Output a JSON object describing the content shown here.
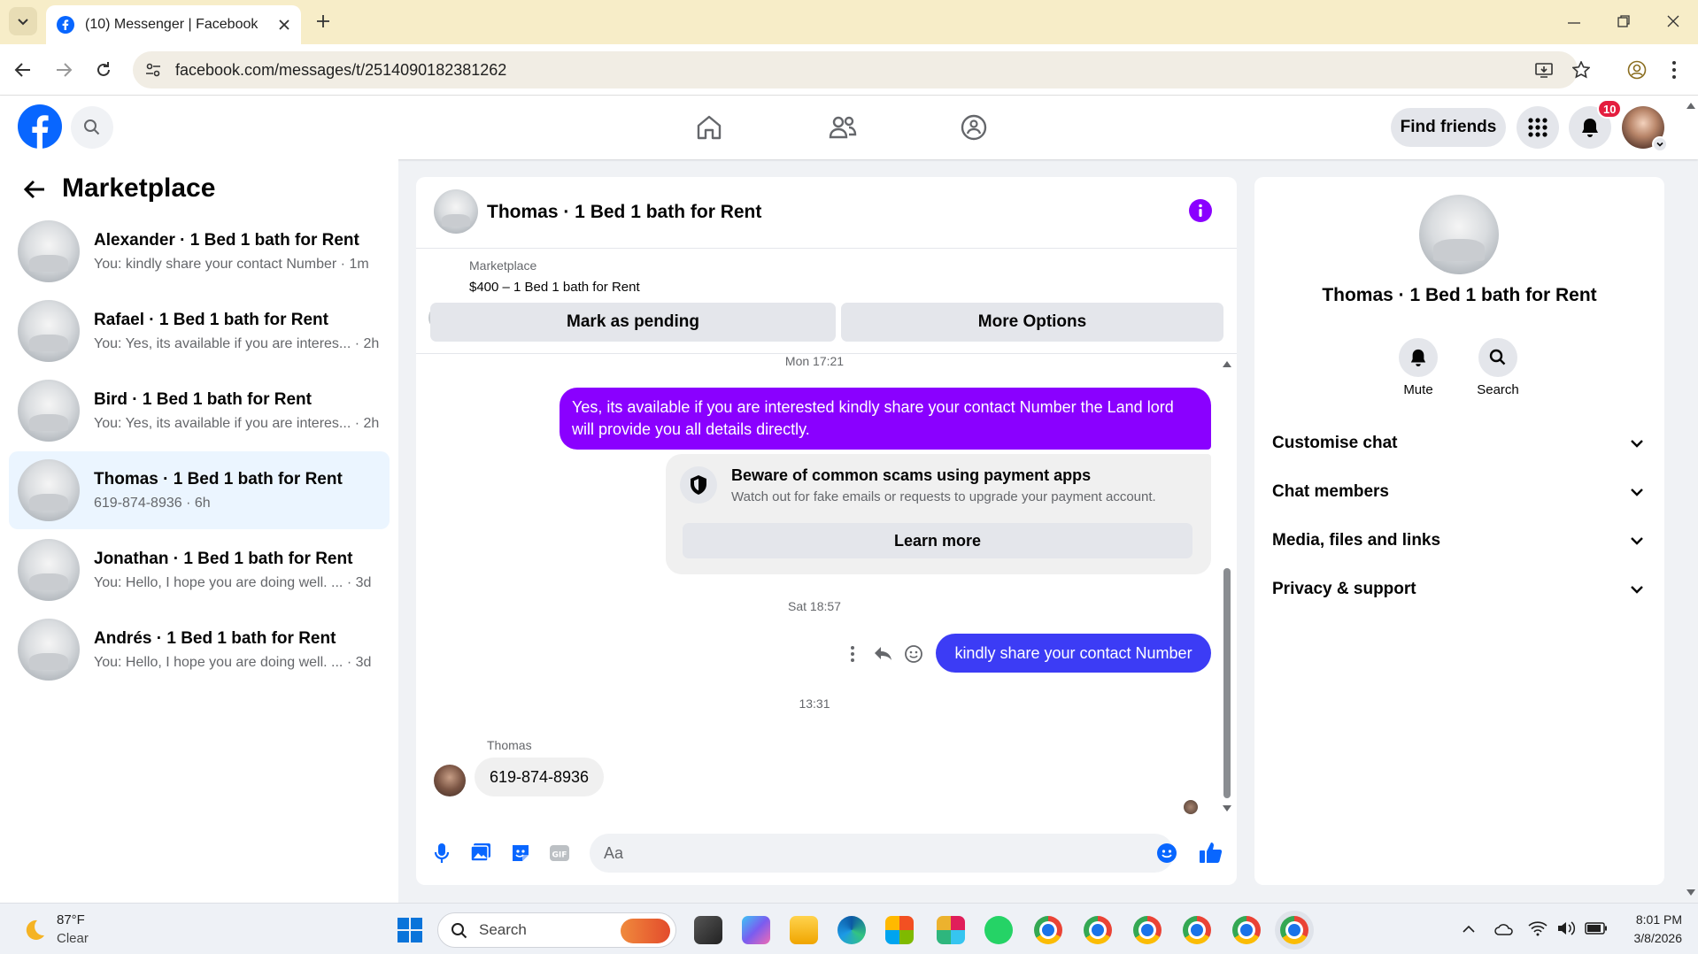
{
  "browser": {
    "tab_title": "(10) Messenger | Facebook",
    "url": "facebook.com/messages/t/2514090182381262"
  },
  "fb_nav": {
    "find_friends_label": "Find friends",
    "notification_count": "10"
  },
  "sidebar": {
    "title": "Marketplace",
    "conversations": [
      {
        "name": "Alexander · 1 Bed 1 bath for Rent",
        "preview": "You: kindly share your contact Number · 1m"
      },
      {
        "name": "Rafael · 1 Bed 1 bath for Rent",
        "preview": "You: Yes, its available if you are interes... · 2h"
      },
      {
        "name": "Bird · 1 Bed 1 bath for Rent",
        "preview": "You: Yes, its available if you are interes... · 2h"
      },
      {
        "name": "Thomas · 1 Bed 1 bath for Rent",
        "preview": "619-874-8936 · 6h"
      },
      {
        "name": "Jonathan · 1 Bed 1 bath for Rent",
        "preview": "You: Hello, I hope you are doing well. ... · 3d"
      },
      {
        "name": "Andrés · 1 Bed 1 bath for Rent",
        "preview": "You: Hello, I hope you are doing well. ... · 3d"
      }
    ]
  },
  "chat": {
    "title": "Thomas · 1 Bed 1 bath for Rent",
    "listing_source": "Marketplace",
    "listing_title": "$400 – 1 Bed 1 bath for Rent",
    "mark_pending_label": "Mark as pending",
    "more_options_label": "More Options",
    "messages": {
      "time1": "Mon 17:21",
      "sent1": "Yes, its available if you are interested kindly share your contact Number the Land lord will provide you all details directly.",
      "scam_title": "Beware of common scams using payment apps",
      "scam_text": "Watch out for fake emails or requests to upgrade your payment account.",
      "learn_more_label": "Learn more",
      "time2": "Sat 18:57",
      "sent2": "kindly share your contact Number",
      "time3": "13:31",
      "sender_name": "Thomas",
      "received1": "619-874-8936"
    },
    "composer_placeholder": "Aa"
  },
  "details": {
    "name": "Thomas · 1 Bed 1 bath for Rent",
    "mute_label": "Mute",
    "search_label": "Search",
    "sections": [
      "Customise chat",
      "Chat members",
      "Media, files and links",
      "Privacy & support"
    ]
  },
  "taskbar": {
    "weather_temp": "87°F",
    "weather_desc": "Clear",
    "search_label": "Search",
    "time": "8:01 PM",
    "date": "3/8/2026"
  },
  "colors": {
    "fb_blue": "#0866ff",
    "purple_bubble": "#8a00ff",
    "blue_bubble": "#3c3cf5",
    "notification_red": "#e41e3f"
  }
}
